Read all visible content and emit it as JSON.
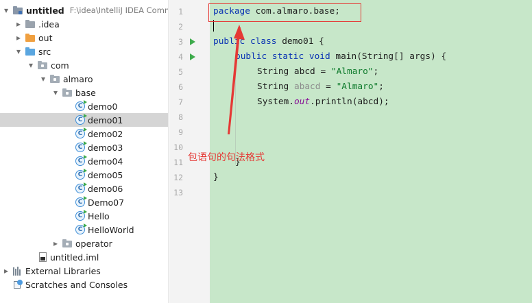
{
  "project_tree": {
    "rows": [
      {
        "label": "untitled",
        "path": "F:\\idea\\IntelliJ IDEA Comm",
        "type": "module",
        "depth": 0,
        "arrow": "down",
        "bold": true
      },
      {
        "label": ".idea",
        "type": "folder-gray",
        "depth": 1,
        "arrow": "right"
      },
      {
        "label": "out",
        "type": "folder-orange",
        "depth": 1,
        "arrow": "right"
      },
      {
        "label": "src",
        "type": "folder-blue",
        "depth": 1,
        "arrow": "down"
      },
      {
        "label": "com",
        "type": "package",
        "depth": 2,
        "arrow": "down"
      },
      {
        "label": "almaro",
        "type": "package",
        "depth": 3,
        "arrow": "down"
      },
      {
        "label": "base",
        "type": "package",
        "depth": 4,
        "arrow": "down"
      },
      {
        "label": "demo0",
        "type": "class",
        "depth": 5,
        "arrow": "none"
      },
      {
        "label": "demo01",
        "type": "class",
        "depth": 5,
        "arrow": "none",
        "selected": true
      },
      {
        "label": "demo02",
        "type": "class",
        "depth": 5,
        "arrow": "none"
      },
      {
        "label": "demo03",
        "type": "class",
        "depth": 5,
        "arrow": "none"
      },
      {
        "label": "demo04",
        "type": "class",
        "depth": 5,
        "arrow": "none"
      },
      {
        "label": "demo05",
        "type": "class",
        "depth": 5,
        "arrow": "none"
      },
      {
        "label": "demo06",
        "type": "class",
        "depth": 5,
        "arrow": "none"
      },
      {
        "label": "Demo07",
        "type": "class",
        "depth": 5,
        "arrow": "none"
      },
      {
        "label": "Hello",
        "type": "class",
        "depth": 5,
        "arrow": "none"
      },
      {
        "label": "HelloWorld",
        "type": "class",
        "depth": 5,
        "arrow": "none"
      },
      {
        "label": "operator",
        "type": "package",
        "depth": 4,
        "arrow": "right"
      },
      {
        "label": "untitled.iml",
        "type": "iml",
        "depth": 2,
        "arrow": "none"
      },
      {
        "label": "External Libraries",
        "type": "libraries",
        "depth": 0,
        "arrow": "right"
      },
      {
        "label": "Scratches and Consoles",
        "type": "scratches",
        "depth": 0,
        "arrow": "none"
      }
    ]
  },
  "editor": {
    "line_numbers": [
      "1",
      "2",
      "3",
      "4",
      "5",
      "6",
      "7",
      "8",
      "9",
      "10",
      "11",
      "12",
      "13"
    ],
    "run_gutter_lines": [
      3,
      4
    ],
    "lines": {
      "l1_kw": "package",
      "l1_rest": " com.almaro.base;",
      "l3_kw1": "public",
      "l3_kw2": "class",
      "l3_rest": " demo01 {",
      "l4_kw": "public static void",
      "l4_rest": " main(String[] args) {",
      "l5_a": "String abcd = ",
      "l5_str": "\"Almaro\"",
      "l5_end": ";",
      "l6_a": "String ",
      "l6_unused": "abacd",
      "l6_b": " = ",
      "l6_str": "\"Almaro\"",
      "l6_end": ";",
      "l7_a": "System.",
      "l7_out": "out",
      "l7_b": ".println(abcd);",
      "l11": "}",
      "l12": "}"
    }
  },
  "annotation": {
    "text": "包语句的句法格式",
    "color": "#e53935"
  },
  "colors": {
    "code_background": "#c7e7c9",
    "keyword": "#0a33b3",
    "string": "#0d7a2b",
    "selection_row": "#d5d5d5"
  }
}
